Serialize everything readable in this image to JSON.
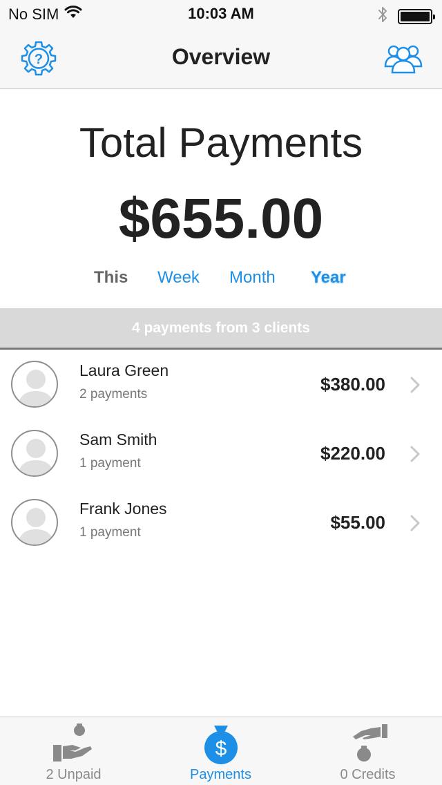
{
  "status_bar": {
    "carrier": "No SIM",
    "time": "10:03 AM",
    "battery_level": 1.0
  },
  "nav": {
    "title": "Overview",
    "left_icon": "help-gear-icon",
    "right_icon": "users-group-icon"
  },
  "summary": {
    "title": "Total Payments",
    "amount": "$655.00"
  },
  "period": {
    "label": "This",
    "options": [
      {
        "label": "Week",
        "active": false
      },
      {
        "label": "Month",
        "active": false
      },
      {
        "label": "Year",
        "active": true
      }
    ]
  },
  "section": {
    "text": "4 payments from 3 clients"
  },
  "clients": [
    {
      "name": "Laura Green",
      "sub": "2 payments",
      "amount": "$380.00"
    },
    {
      "name": "Sam Smith",
      "sub": "1 payment",
      "amount": "$220.00"
    },
    {
      "name": "Frank Jones",
      "sub": "1 payment",
      "amount": "$55.00"
    }
  ],
  "tabs": [
    {
      "label": "2 Unpaid",
      "icon": "hand-moneybag-icon",
      "active": false
    },
    {
      "label": "Payments",
      "icon": "dollar-bag-icon",
      "active": true
    },
    {
      "label": "0 Credits",
      "icon": "hand-drop-bag-icon",
      "active": false
    }
  ],
  "colors": {
    "accent": "#1e8fe6",
    "section_bg": "#d9d9d9",
    "inactive": "#8a8a8a"
  }
}
